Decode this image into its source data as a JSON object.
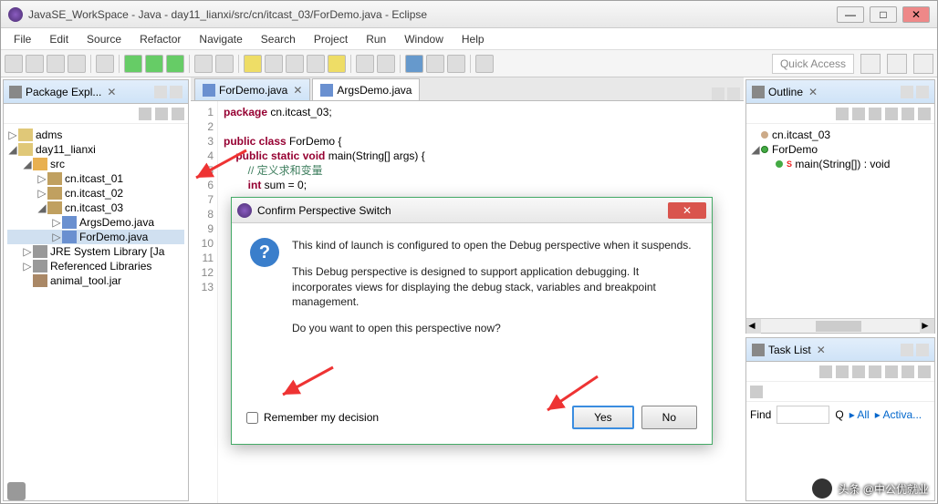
{
  "window": {
    "title": "JavaSE_WorkSpace - Java - day11_lianxi/src/cn/itcast_03/ForDemo.java - Eclipse"
  },
  "menu": [
    "File",
    "Edit",
    "Source",
    "Refactor",
    "Navigate",
    "Search",
    "Project",
    "Run",
    "Window",
    "Help"
  ],
  "quick_access": "Quick Access",
  "pkg_explorer": {
    "title": "Package Expl...",
    "items": {
      "adms": "adms",
      "day11": "day11_lianxi",
      "src": "src",
      "p1": "cn.itcast_01",
      "p2": "cn.itcast_02",
      "p3": "cn.itcast_03",
      "f1": "ArgsDemo.java",
      "f2": "ForDemo.java",
      "jre": "JRE System Library [Ja",
      "ref": "Referenced Libraries",
      "jar": "animal_tool.jar"
    }
  },
  "editor": {
    "tab1": "ForDemo.java",
    "tab2": "ArgsDemo.java",
    "lines": {
      "1": {
        "kw": "package",
        "rest": " cn.itcast_03;"
      },
      "3a": "public class ",
      "3b": "ForDemo {",
      "4a": "public static void ",
      "4b": "main(String[] args) {",
      "5": "// 定义求和变量",
      "6a": "int",
      "6b": " sum = 0;"
    }
  },
  "outline": {
    "title": "Outline",
    "pkg": "cn.itcast_03",
    "class": "ForDemo",
    "method": "main(String[]) : void"
  },
  "tasklist": {
    "title": "Task List",
    "find_label": "Find",
    "find_value": "",
    "all": "All",
    "activa": "Activa..."
  },
  "dialog": {
    "title": "Confirm Perspective Switch",
    "p1": "This kind of launch is configured to open the Debug perspective when it suspends.",
    "p2": "This Debug perspective is designed to support application debugging.  It incorporates views for displaying the debug stack, variables and breakpoint management.",
    "p3": "Do you want to open this perspective now?",
    "remember": "Remember my decision",
    "yes": "Yes",
    "no": "No"
  },
  "watermark": "头条 @中公优就业"
}
